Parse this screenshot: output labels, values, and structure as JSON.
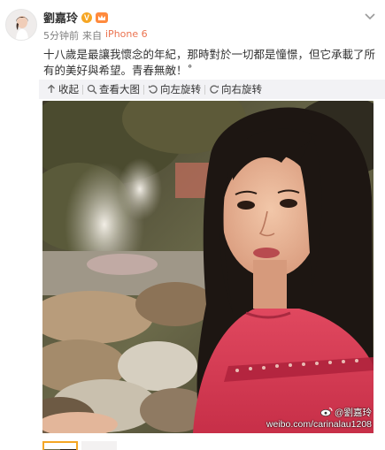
{
  "author": {
    "name": "劉嘉玲"
  },
  "meta": {
    "time": "5分钟前",
    "source": "来自",
    "device": "iPhone 6"
  },
  "post": {
    "text": "十八歲是最讓我懷念的年紀，那時對於一切都是憧憬，但它承載了所有的美好與希望。青春無敵！˚"
  },
  "toolbar": {
    "collapse": "收起",
    "view_large": "查看大图",
    "rotate_left": "向左旋转",
    "rotate_right": "向右旋转"
  },
  "watermark": {
    "handle": "@劉嘉玲",
    "url": "weibo.com/carinalau1208"
  },
  "icons": {
    "verified": "verified-v-icon",
    "crown": "crown-icon",
    "more": "chevron-down-icon",
    "collapse": "arrow-up-icon",
    "view_large": "magnify-icon",
    "rotate_left": "rotate-left-icon",
    "rotate_right": "rotate-right-icon"
  },
  "colors": {
    "device_link": "#eb7350",
    "verified_badge": "#f6a623",
    "toolbar_bg": "#f2f2f5",
    "thumb_border": "#f5a623"
  }
}
